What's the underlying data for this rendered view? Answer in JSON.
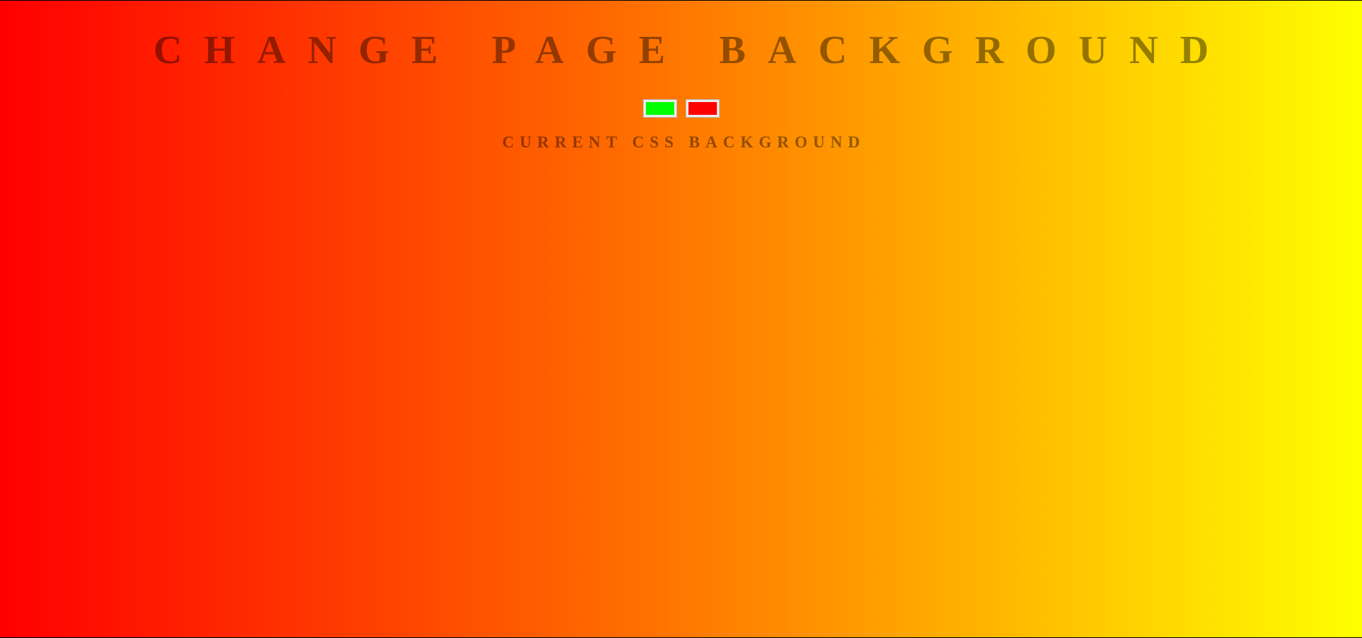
{
  "page": {
    "title": "CHANGE PAGE BACKGROUND",
    "subtitle": "CURRENT CSS BACKGROUND"
  },
  "background": {
    "gradient_direction": "to right",
    "colors": [
      "#ff0000",
      "#ff6a00",
      "#ffae00",
      "#ffff00"
    ]
  },
  "color_pickers": [
    {
      "name": "color-1",
      "value": "#00ff00"
    },
    {
      "name": "color-2",
      "value": "#ff0000"
    }
  ]
}
